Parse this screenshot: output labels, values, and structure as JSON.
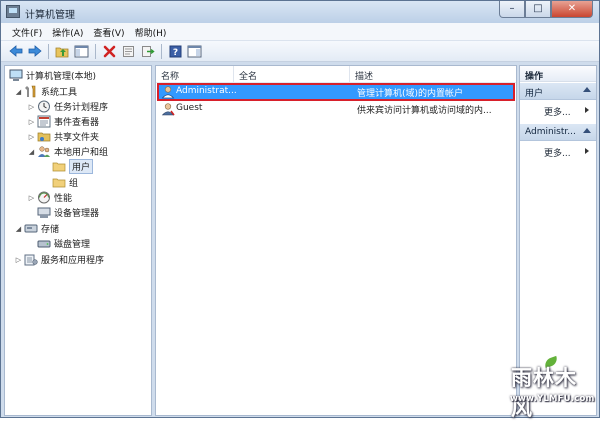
{
  "window": {
    "title": "计算机管理"
  },
  "title_buttons": {
    "minimize": "–",
    "maximize": "□",
    "close": "✕"
  },
  "menu": [
    "文件(F)",
    "操作(A)",
    "查看(V)",
    "帮助(H)"
  ],
  "toolbar_icons": [
    "back-arrow-icon",
    "forward-arrow-icon",
    "up-folder-icon",
    "show-hide-tree-icon",
    "delete-icon",
    "properties-icon",
    "export-icon",
    "help-icon",
    "show-hide-action-pane-icon"
  ],
  "tree": {
    "root": "计算机管理(本地)",
    "system_tools": "系统工具",
    "task_scheduler": "任务计划程序",
    "event_viewer": "事件查看器",
    "shared_folders": "共享文件夹",
    "local_users_groups": "本地用户和组",
    "users": "用户",
    "groups": "组",
    "performance": "性能",
    "device_manager": "设备管理器",
    "storage": "存储",
    "disk_management": "磁盘管理",
    "services_apps": "服务和应用程序"
  },
  "list": {
    "columns": {
      "name": "名称",
      "full_name": "全名",
      "description": "描述"
    },
    "rows": [
      {
        "name": "Administrat...",
        "full_name": "",
        "description": "管理计算机(域)的内置帐户"
      },
      {
        "name": "Guest",
        "full_name": "",
        "description": "供来宾访问计算机或访问域的内..."
      }
    ]
  },
  "actions": {
    "header": "操作",
    "section1": "用户",
    "section1_more": "更多...",
    "section2": "Administr...",
    "section2_more": "更多..."
  },
  "watermark": {
    "logo": "雨林木风",
    "url": "www.YLMFU.com"
  },
  "colors": {
    "selection": "#3399ff",
    "highlight_border": "#d8202b"
  }
}
